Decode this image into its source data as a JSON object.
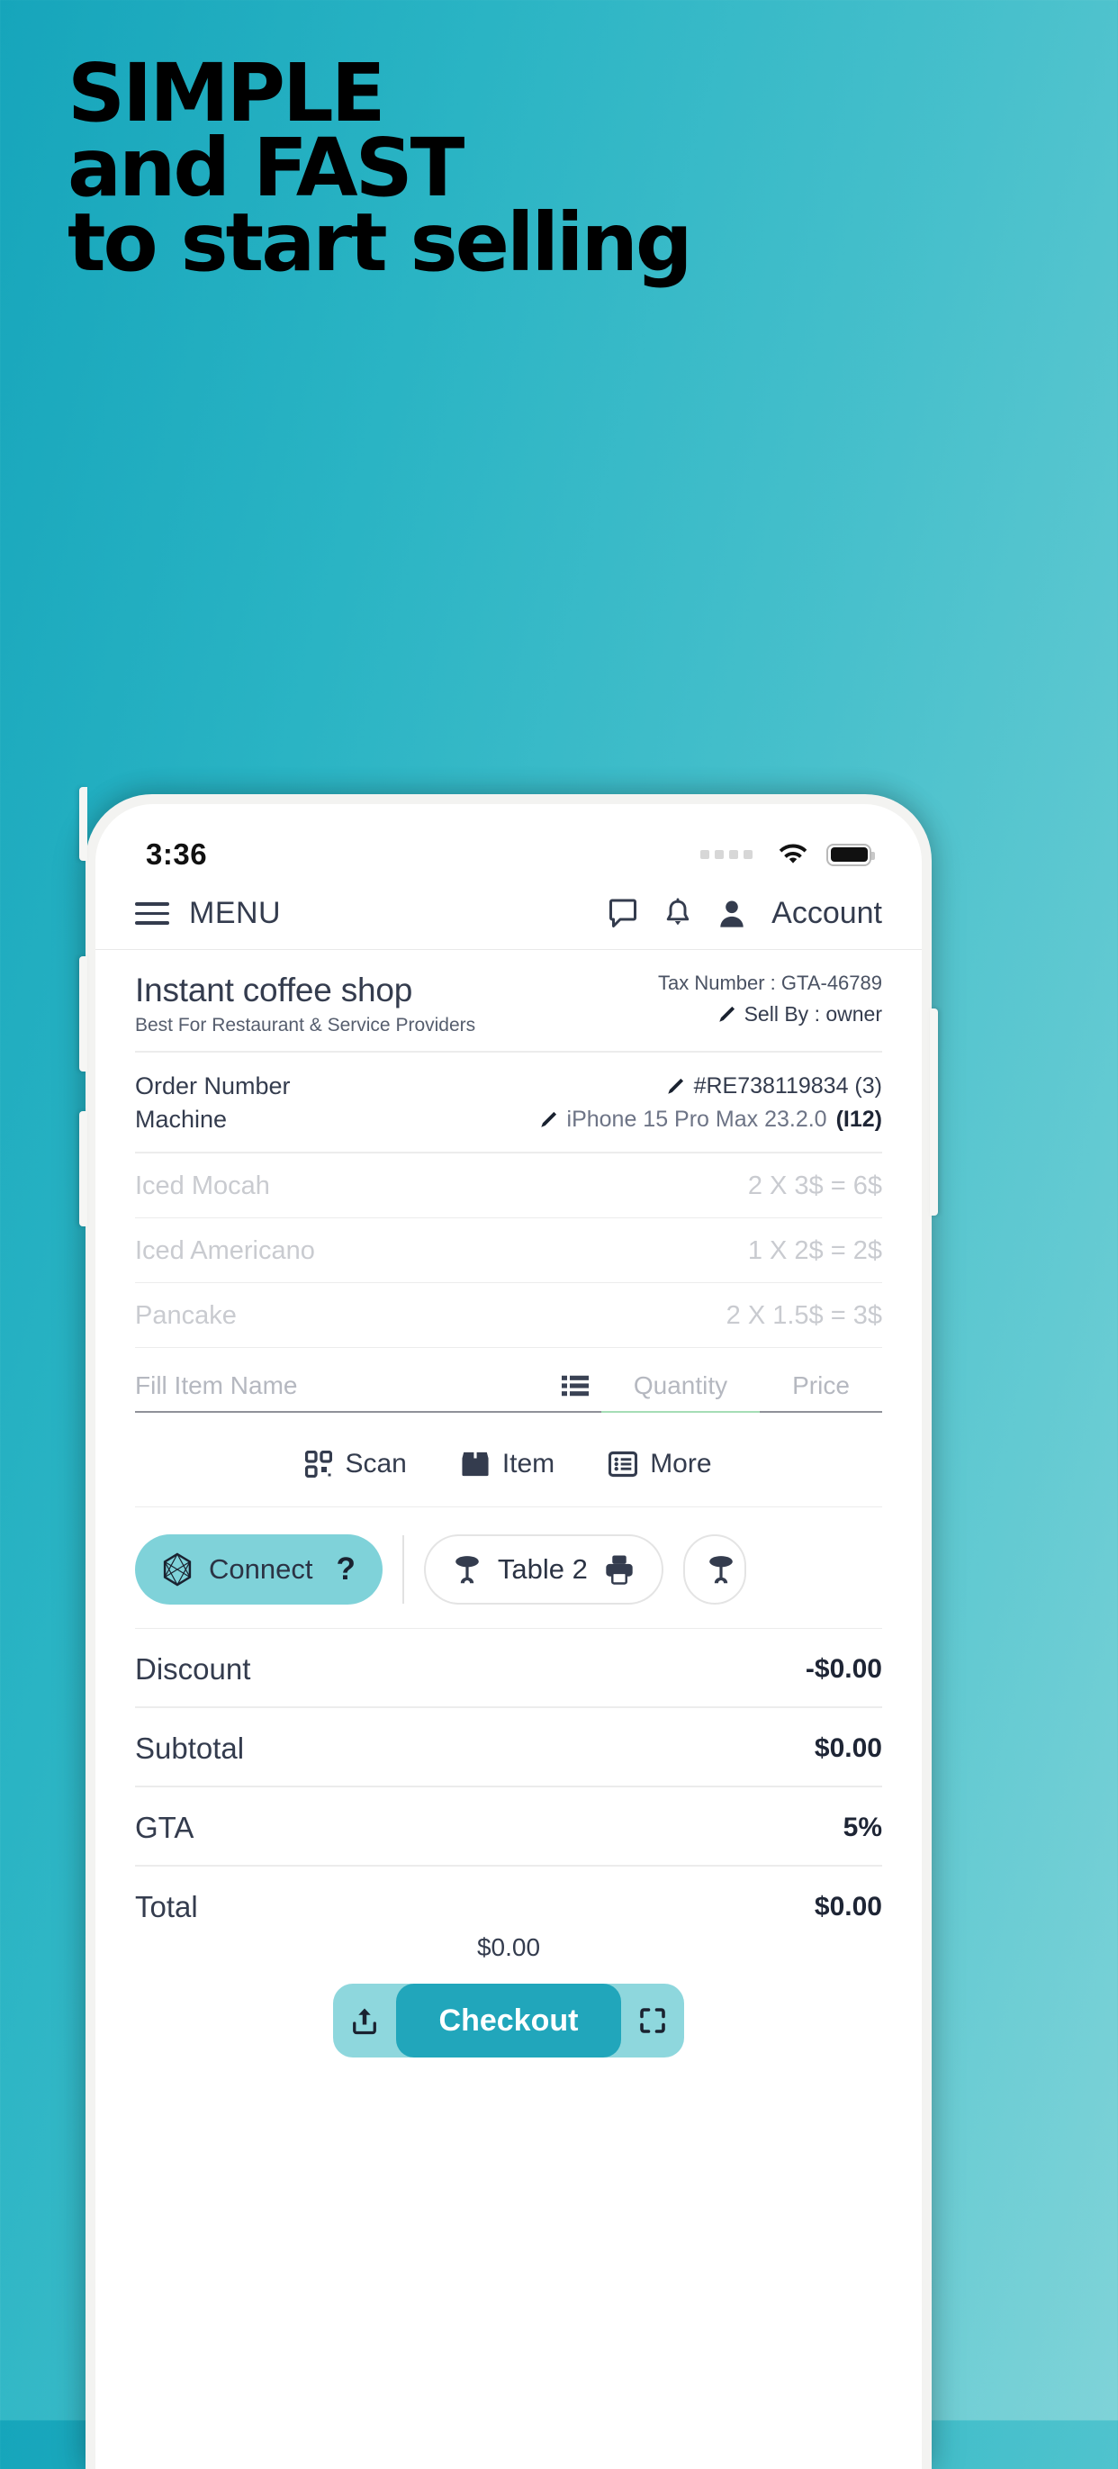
{
  "hero": {
    "line1": "SIMPLE",
    "line2": "and FAST",
    "line3": "to start selling"
  },
  "colors": {
    "background_start": "#16a5bb",
    "background_end": "#7fd3d8",
    "accent": "#21a6bb",
    "chip_primary": "#7fd2d9",
    "text_dark": "#343c4e"
  },
  "phone": {
    "statusbar": {
      "time": "3:36",
      "signal_icon": "signal-dots-icon",
      "wifi_icon": "wifi-icon",
      "battery_icon": "battery-icon"
    },
    "menubar": {
      "menu_icon": "hamburger-icon",
      "menu_label": "MENU",
      "chat_icon": "chat-bubble-icon",
      "bell_icon": "bell-icon",
      "person_icon": "person-icon",
      "account_label": "Account"
    },
    "shop": {
      "name": "Instant coffee shop",
      "subtitle": "Best For Restaurant & Service Providers",
      "tax_number": "Tax Number : GTA-46789",
      "sell_by": "Sell By : owner",
      "edit_icon": "pencil-icon"
    },
    "order": {
      "rows": [
        {
          "label": "Order Number",
          "value": "#RE738119834 (3)",
          "bold_suffix": "",
          "icon": "pencil-icon",
          "muted": false
        },
        {
          "label": "Machine",
          "value": "iPhone 15 Pro Max 23.2.0",
          "bold_suffix": "(I12)",
          "icon": "pencil-icon",
          "muted": true
        }
      ]
    },
    "items": [
      {
        "name": "Iced Mocah",
        "detail": "2 X 3$ = 6$"
      },
      {
        "name": "Iced Americano",
        "detail": "1 X 2$ = 2$"
      },
      {
        "name": "Pancake",
        "detail": "2 X 1.5$ = 3$"
      }
    ],
    "entry": {
      "name_placeholder": "Fill Item Name",
      "list_icon": "list-icon",
      "quantity_placeholder": "Quantity",
      "price_placeholder": "Price"
    },
    "actions": [
      {
        "label": "Scan",
        "icon": "qr-scan-icon"
      },
      {
        "label": "Item",
        "icon": "box-icon"
      },
      {
        "label": "More",
        "icon": "list-box-icon"
      }
    ],
    "chips": [
      {
        "label": "Connect",
        "icon": "hexagon-network-icon",
        "suffix": "?",
        "style": "primary"
      },
      {
        "label": "Table 2",
        "icon": "table-icon",
        "trailing_icon": "printer-icon",
        "style": "outline"
      },
      {
        "label": "",
        "icon": "table-icon",
        "style": "partial"
      }
    ],
    "totals": [
      {
        "label": "Discount",
        "value": "-$0.00"
      },
      {
        "label": "Subtotal",
        "value": "$0.00"
      },
      {
        "label": "GTA",
        "value": "5%"
      },
      {
        "label": "Total",
        "value": "$0.00"
      }
    ],
    "grand_total": "$0.00",
    "checkout": {
      "share_icon": "share-upload-icon",
      "label": "Checkout",
      "expand_icon": "fullscreen-icon"
    }
  }
}
